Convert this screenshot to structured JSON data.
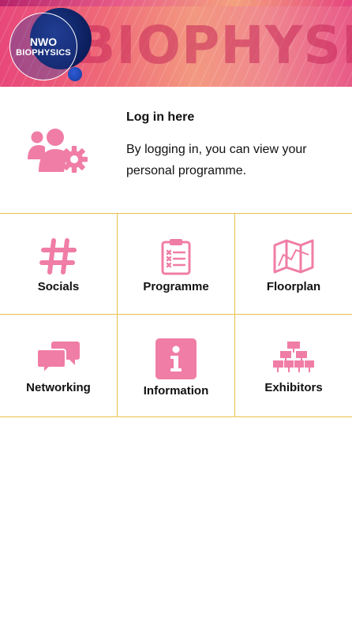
{
  "banner": {
    "logo_line1": "NWO",
    "logo_line2": "BIOPHYSICS",
    "wordmark": "BIOPHYSICS"
  },
  "login": {
    "title": "Log in here",
    "description": "By logging in, you can view your personal programme."
  },
  "menu": [
    {
      "label": "Socials",
      "icon": "hashtag-icon"
    },
    {
      "label": "Programme",
      "icon": "clipboard-list-icon"
    },
    {
      "label": "Floorplan",
      "icon": "folded-map-icon"
    },
    {
      "label": "Networking",
      "icon": "chat-bubbles-icon"
    },
    {
      "label": "Information",
      "icon": "info-icon"
    },
    {
      "label": "Exhibitors",
      "icon": "booth-stands-icon"
    }
  ],
  "colors": {
    "accent_pink": "#f07da6",
    "grid_lines": "#e8c24a",
    "banner_pink": "#e8477a"
  }
}
